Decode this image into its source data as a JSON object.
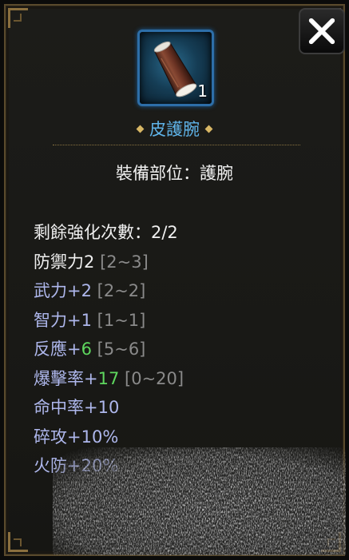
{
  "close_button": {
    "label": "close-icon"
  },
  "item": {
    "count": "1",
    "name": "皮護腕",
    "equip_slot": "裝備部位：護腕"
  },
  "stats": [
    {
      "label": "剩餘強化次數：2/2",
      "color": "white"
    },
    {
      "label": "防禦力2",
      "range": "[2~3]",
      "color": "white"
    },
    {
      "label": "武力+2",
      "range": "[2~2]",
      "color": "blue"
    },
    {
      "label": "智力+1",
      "range": "[1~1]",
      "color": "blue"
    },
    {
      "label": "反應+",
      "bonus": "6",
      "range": "[5~6]",
      "color": "blue"
    },
    {
      "label": "爆擊率+",
      "bonus": "17",
      "range": "[0~20]",
      "color": "blue"
    },
    {
      "label": "命中率+10",
      "color": "blue"
    },
    {
      "label": "碎攻+10%",
      "color": "blue"
    },
    {
      "label": "火防+20%",
      "color": "blue"
    }
  ],
  "colors": {
    "item_name": "#5fb3e8",
    "stat_white": "#f0f0f0",
    "stat_blue": "#aeb7ec",
    "stat_green": "#5ed75e",
    "range_gray": "#8a8a8a",
    "frame_gold": "#8a6f3e",
    "icon_border": "#2d6ea8"
  }
}
